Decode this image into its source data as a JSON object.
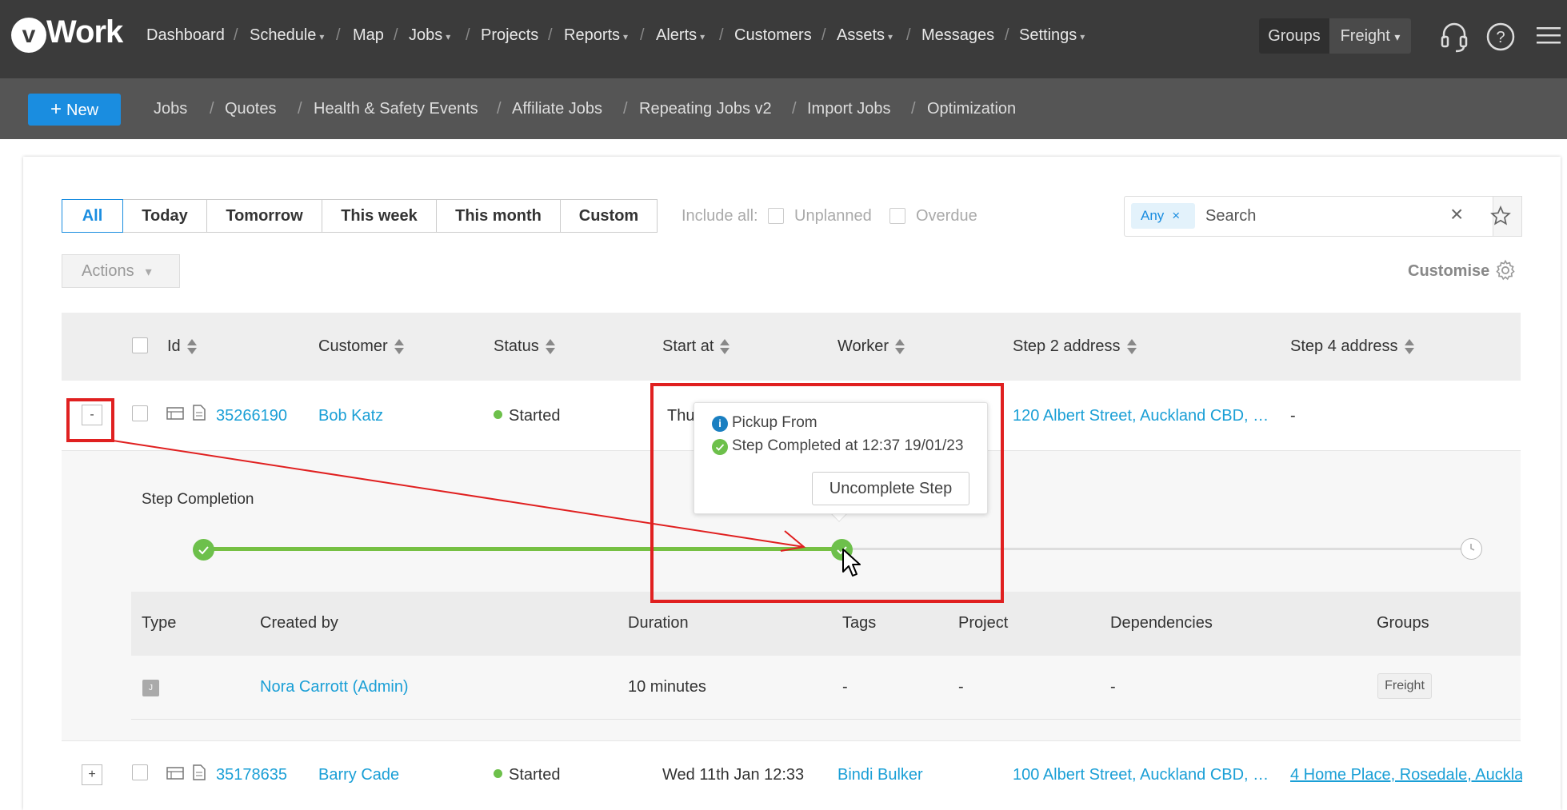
{
  "brand": {
    "logo_letter": "v",
    "logo_text": "Work"
  },
  "topnav": {
    "items": [
      {
        "label": "Dashboard"
      },
      {
        "label": "Schedule",
        "dropdown": true
      },
      {
        "label": "Map"
      },
      {
        "label": "Jobs",
        "dropdown": true
      },
      {
        "label": "Projects"
      },
      {
        "label": "Reports",
        "dropdown": true
      },
      {
        "label": "Alerts",
        "dropdown": true
      },
      {
        "label": "Customers"
      },
      {
        "label": "Assets",
        "dropdown": true
      },
      {
        "label": "Messages"
      },
      {
        "label": "Settings",
        "dropdown": true
      }
    ],
    "caret": "▾",
    "separator": "/",
    "groups_label": "Groups",
    "groups_value": "Freight",
    "icons": [
      "headset-icon",
      "help-icon",
      "hamburger-menu-icon"
    ]
  },
  "subnav": {
    "new_label": "New",
    "items": [
      "Jobs",
      "Quotes",
      "Health & Safety Events",
      "Affiliate Jobs",
      "Repeating Jobs v2",
      "Import Jobs",
      "Optimization"
    ]
  },
  "filters": {
    "date_buttons": [
      "All",
      "Today",
      "Tomorrow",
      "This week",
      "This month",
      "Custom"
    ],
    "active": "All",
    "include_all_label": "Include all:",
    "unplanned_label": "Unplanned",
    "overdue_label": "Overdue"
  },
  "search": {
    "tag": "Any",
    "placeholder": "Search"
  },
  "actions_label": "Actions",
  "customise_label": "Customise",
  "table": {
    "columns": [
      "Id",
      "Customer",
      "Status",
      "Start at",
      "Worker",
      "Step 2 address",
      "Step 4 address"
    ],
    "rows": [
      {
        "expand": "-",
        "id": "35266190",
        "customer": "Bob Katz",
        "status": "Started",
        "start": "Thu",
        "worker": "",
        "step2": "120 Albert Street, Auckland CBD, …",
        "step4": "-"
      },
      {
        "expand": "+",
        "id": "35178635",
        "customer": "Barry Cade",
        "status": "Started",
        "start": "Wed 11th Jan 12:33",
        "worker": "Bindi Bulker",
        "step2": "100 Albert Street, Auckland CBD, …",
        "step4": "4 Home Place, Rosedale, Aucklar"
      }
    ]
  },
  "detail": {
    "step_completion_label": "Step Completion",
    "columns": [
      "Type",
      "Created by",
      "Duration",
      "Tags",
      "Project",
      "Dependencies",
      "Groups"
    ],
    "row": {
      "type": "J",
      "created_by": "Nora Carrott (Admin)",
      "duration": "10 minutes",
      "tags": "-",
      "project": "-",
      "dependencies": "-",
      "groups": "Freight"
    }
  },
  "tooltip": {
    "title": "Pickup From",
    "status": "Step Completed at 12:37 19/01/23",
    "button": "Uncomplete Step"
  },
  "colors": {
    "accent": "#1a8de0",
    "link": "#1a9fd6",
    "success": "#6dc04b",
    "annotation": "#e02020",
    "topbar": "#3b3b3b",
    "subbar": "#555555"
  }
}
